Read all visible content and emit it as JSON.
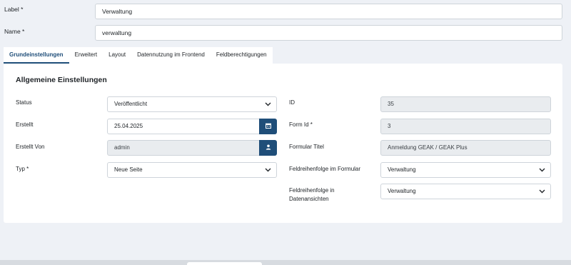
{
  "top": {
    "label_label": "Label *",
    "label_value": "Verwaltung",
    "name_label": "Name *",
    "name_value": "verwaltung"
  },
  "tabs": [
    {
      "label": "Grundeinstellungen",
      "active": true
    },
    {
      "label": "Erweitert",
      "active": false
    },
    {
      "label": "Layout",
      "active": false
    },
    {
      "label": "Datennutzung im Frontend",
      "active": false
    },
    {
      "label": "Feldberechtigungen",
      "active": false
    }
  ],
  "panel": {
    "title": "Allgemeine Einstellungen",
    "left": {
      "status_label": "Status",
      "status_value": "Veröffentlicht",
      "erstellt_label": "Erstellt",
      "erstellt_value": "25.04.2025",
      "erstellt_von_label": "Erstellt Von",
      "erstellt_von_value": "admin",
      "typ_label": "Typ *",
      "typ_value": "Neue Seite"
    },
    "right": {
      "id_label": "ID",
      "id_value": "35",
      "form_id_label": "Form Id *",
      "form_id_value": "3",
      "formular_titel_label": "Formular Titel",
      "formular_titel_value": "Anmeldung GEAK / GEAK Plus",
      "feld_formular_label": "Feldreihenfolge im Formular",
      "feld_formular_value": "Verwaltung",
      "feld_daten_label_1": "Feldreihenfolge in",
      "feld_daten_label_2": "Datenansichten",
      "feld_daten_value": "Verwaltung"
    }
  },
  "icons": {
    "calendar": "calendar-icon",
    "user": "user-icon",
    "chevron": "chevron-down-icon"
  },
  "colors": {
    "accent": "#1f4e79",
    "page_bg": "#eef1f6",
    "readonly_bg": "#e9ecef"
  }
}
